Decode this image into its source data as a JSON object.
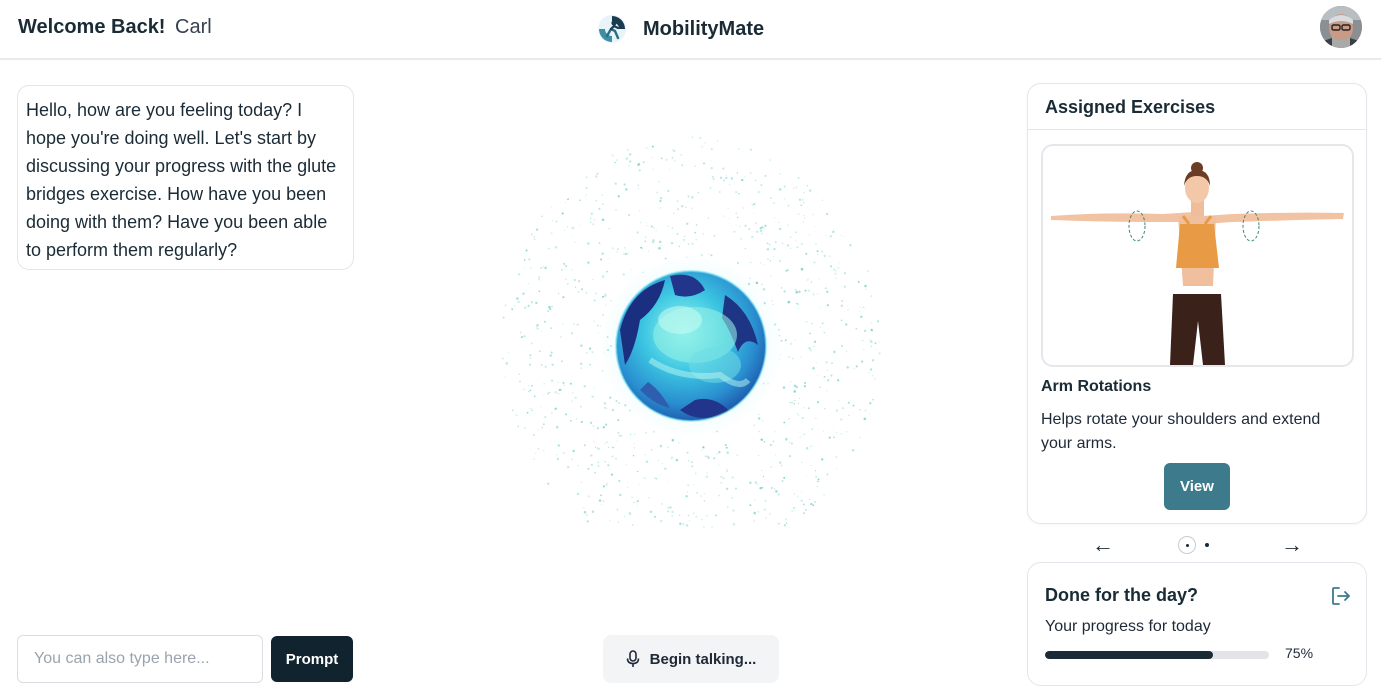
{
  "header": {
    "welcome_bold": "Welcome Back!",
    "user_name": "Carl",
    "app_name": "MobilityMate",
    "logo_icon": "mobility-logo-icon",
    "avatar_icon": "user-avatar"
  },
  "chat": {
    "message": "Hello, how are you feeling today? I hope you're doing well. Let's start by discussing your progress with the glute bridges exercise. How have you been doing with them? Have you been able to perform them regularly?"
  },
  "input": {
    "placeholder": "You can also type here...",
    "value": "",
    "prompt_label": "Prompt"
  },
  "voice": {
    "label": "Begin talking...",
    "icon": "microphone-icon"
  },
  "exercises": {
    "header": "Assigned Exercises",
    "current": {
      "title": "Arm Rotations",
      "description": "Helps rotate your shoulders and extend your arms.",
      "view_label": "View"
    },
    "nav": {
      "prev": "←",
      "next": "→",
      "total_pages": 2,
      "current_page": 1
    }
  },
  "done": {
    "title": "Done for the day?",
    "progress_label": "Your progress for today",
    "progress_percent": 75,
    "progress_text": "75%",
    "logout_icon": "logout-icon"
  },
  "colors": {
    "primary_dark": "#10232e",
    "accent_teal": "#3d7a8b",
    "orb_cyan": "#4fd8e8",
    "orb_blue": "#1d3f8f"
  }
}
